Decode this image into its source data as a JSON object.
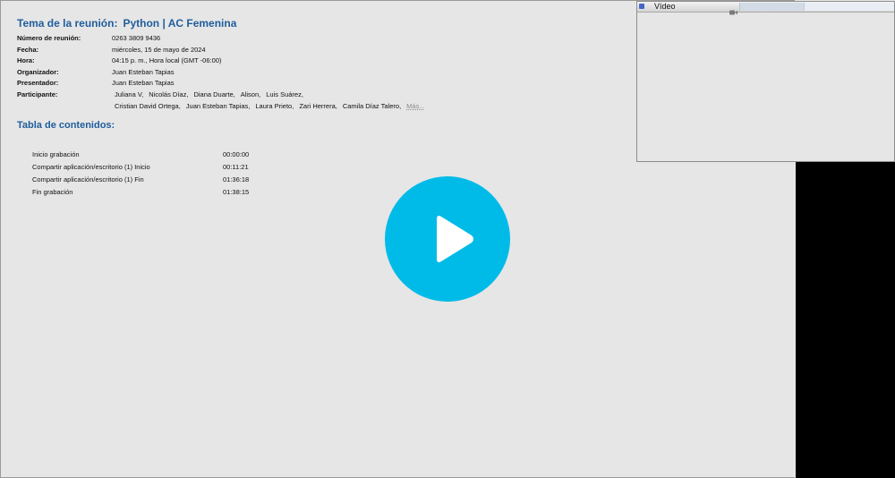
{
  "meeting": {
    "title_label": "Tema de la reunión:",
    "title_value": "Python | AC Femenina"
  },
  "info": [
    {
      "label": "Número de reunión:",
      "value": "0263 3809 9436"
    },
    {
      "label": "Fecha:",
      "value": "miércoles, 15 de mayo de 2024"
    },
    {
      "label": "Hora:",
      "value": "04:15 p. m., Hora local (GMT -06:00)"
    },
    {
      "label": "Organizador:",
      "value": "Juan Esteban Tapias"
    },
    {
      "label": "Presentador:",
      "value": "Juan Esteban Tapias"
    }
  ],
  "participants": {
    "label": "Participante:",
    "line1": [
      "Juliana V,",
      "Nicolás Díaz,",
      "Diana Duarte,",
      "Alison,",
      "Luis Suárez,"
    ],
    "line2": [
      "Cristian David Ortega,",
      "Juan Esteban Tapias,",
      "Laura Prieto,",
      "Zari Herrera,",
      "Camila Díaz Talero,"
    ],
    "more": "Más..."
  },
  "toc": {
    "title": "Tabla de contenidos:",
    "items": [
      {
        "label": "Inicio grabación",
        "time": "00:00:00"
      },
      {
        "label": "Compartir aplicación/escritorio (1) Inicio",
        "time": "00:11:21"
      },
      {
        "label": "Compartir aplicación/escritorio (1) Fin",
        "time": "01:36:18"
      },
      {
        "label": "Fin grabación",
        "time": "01:38:15"
      }
    ]
  },
  "video_panel": {
    "title": "Vídeo",
    "icon": "camera-icon"
  },
  "play": {
    "icon": "play-icon",
    "color": "#00bbe8"
  },
  "colors": {
    "heading": "#1f5d9c",
    "background": "#e6e6e6",
    "black_strip": "#000000"
  }
}
